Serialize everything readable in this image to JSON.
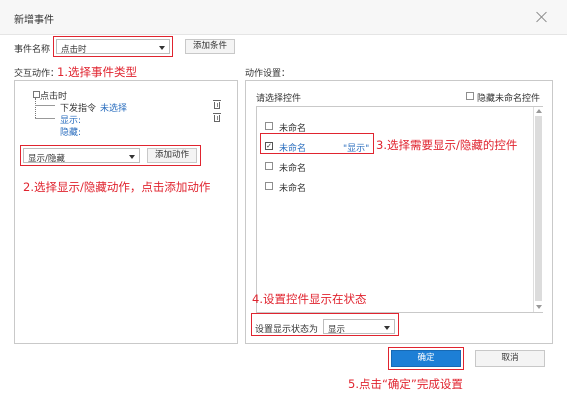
{
  "dialog": {
    "title": "新增事件"
  },
  "event": {
    "name_label": "事件名称",
    "name_value": "点击时",
    "add_condition": "添加条件"
  },
  "interaction": {
    "label": "交互动作：",
    "tree": {
      "root": "点击时",
      "cmd_label": "下发指令",
      "cmd_value": "未选择",
      "show": "显示:",
      "hide": "隐藏:"
    },
    "action_value": "显示/隐藏",
    "add_action": "添加动作"
  },
  "action_settings": {
    "label": "动作设置：",
    "select_control": "请选择控件",
    "hide_unnamed": "隐藏未命名控件",
    "controls": [
      {
        "name": "未命名",
        "checked": false,
        "status": ""
      },
      {
        "name": "未命名",
        "checked": true,
        "status": "\"显示\""
      },
      {
        "name": "未命名",
        "checked": false,
        "status": ""
      },
      {
        "name": "未命名",
        "checked": false,
        "status": ""
      }
    ],
    "state_label": "设置显示状态为",
    "state_value": "显示"
  },
  "footer": {
    "ok": "确定",
    "cancel": "取消"
  },
  "annotations": {
    "a1": "1.选择事件类型",
    "a2": "2.选择显示/隐藏动作，点击添加动作",
    "a3": "3.选择需要显示/隐藏的控件",
    "a4": "4.设置控件显示在状态",
    "a5": "5.点击“确定”完成设置"
  },
  "colors": {
    "annotation": "#e0242f",
    "primary": "#1d7fd6",
    "link": "#2c6fbf"
  }
}
